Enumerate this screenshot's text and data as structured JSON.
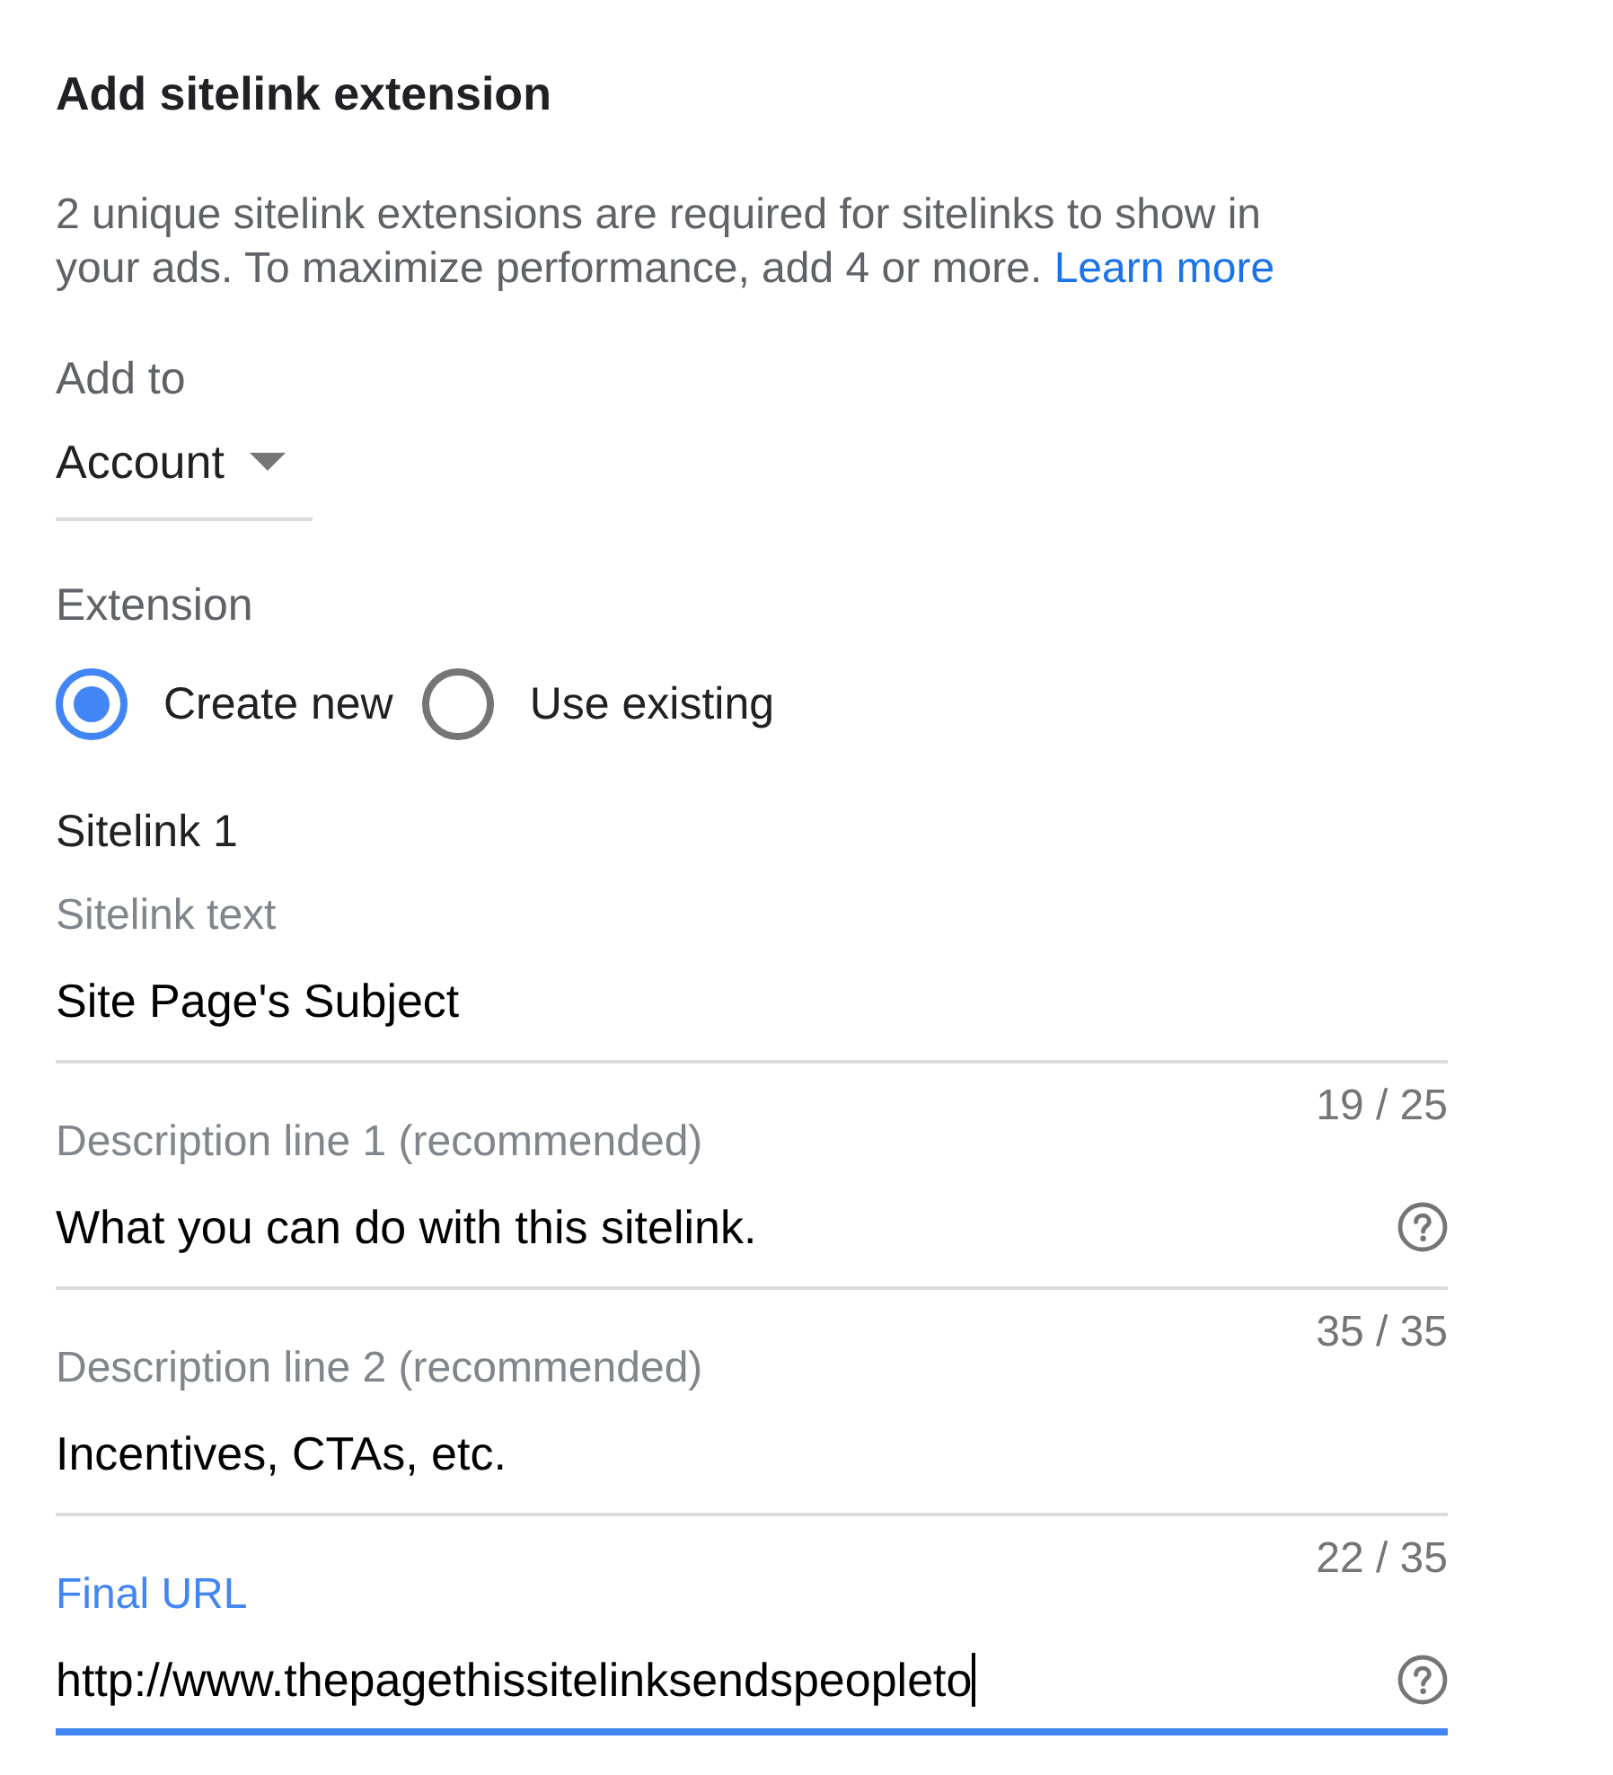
{
  "title": "Add sitelink extension",
  "notice": {
    "text": "2 unique sitelink extensions are required for sitelinks to show in your ads. To maximize performance, add 4 or more.",
    "link": "Learn more"
  },
  "add_to": {
    "label": "Add to",
    "value": "Account"
  },
  "extension": {
    "label": "Extension",
    "options": [
      {
        "label": "Create new",
        "selected": true
      },
      {
        "label": "Use existing",
        "selected": false
      }
    ]
  },
  "sitelink": {
    "heading": "Sitelink 1",
    "fields": [
      {
        "label": "Sitelink text",
        "value": "Site Page's Subject",
        "counter": "19 / 25",
        "help": false,
        "focused": false
      },
      {
        "label": "Description line 1 (recommended)",
        "value": "What you can do with this sitelink.",
        "counter": "35 / 35",
        "help": true,
        "focused": false
      },
      {
        "label": "Description line 2 (recommended)",
        "value": "Incentives, CTAs, etc.",
        "counter": "22 / 35",
        "help": false,
        "focused": false
      },
      {
        "label": "Final URL",
        "value": "http://www.thepagethissitelinksendspeopleto",
        "help": true,
        "focused": true
      }
    ]
  }
}
